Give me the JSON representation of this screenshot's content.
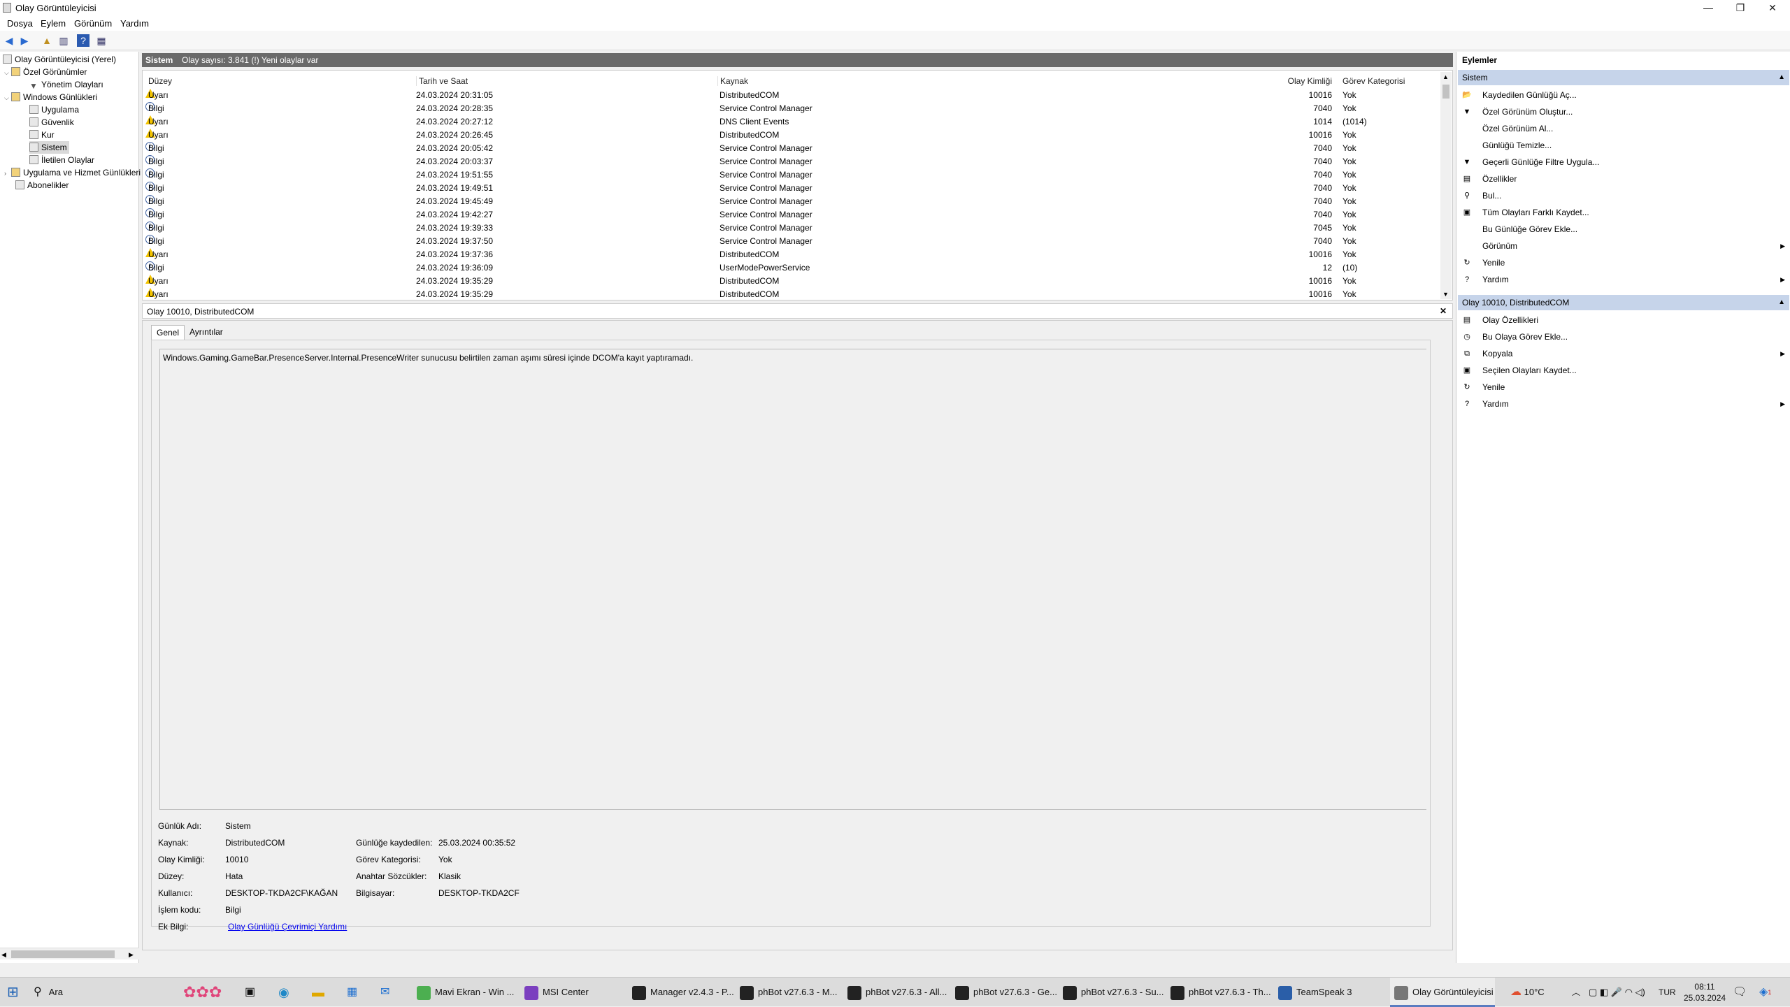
{
  "window": {
    "title": "Olay Görüntüleyicisi",
    "controls": {
      "minimize": "—",
      "restore": "❐",
      "close": "✕"
    }
  },
  "menu": [
    "Dosya",
    "Eylem",
    "Görünüm",
    "Yardım"
  ],
  "tree": {
    "items": [
      {
        "label": "Olay Görüntüleyicisi (Yerel)",
        "icon": "event-viewer-icon"
      },
      {
        "label": "Özel Görünümler",
        "icon": "folder-icon",
        "toggle": "⌵"
      },
      {
        "label": "Yönetim Olayları",
        "icon": "filter-icon"
      },
      {
        "label": "Windows Günlükleri",
        "icon": "folder-icon",
        "toggle": "⌵"
      },
      {
        "label": "Uygulama",
        "icon": "log-icon"
      },
      {
        "label": "Güvenlik",
        "icon": "log-icon"
      },
      {
        "label": "Kur",
        "icon": "log-icon"
      },
      {
        "label": "Sistem",
        "icon": "log-icon"
      },
      {
        "label": "İletilen Olaylar",
        "icon": "log-icon"
      },
      {
        "label": "Uygulama ve Hizmet Günlükleri",
        "icon": "folder-icon",
        "toggle": "›"
      },
      {
        "label": "Abonelikler",
        "icon": "subscriptions-icon"
      }
    ]
  },
  "list": {
    "title": "Sistem",
    "subtitle": "Olay sayısı: 3.841 (!) Yeni olaylar var",
    "columns": [
      "Düzey",
      "Tarih ve Saat",
      "Kaynak",
      "Olay Kimliği",
      "Görev Kategorisi"
    ],
    "rows": [
      {
        "level": "Uyarı",
        "type": "warn",
        "date": "24.03.2024 20:31:05",
        "source": "DistributedCOM",
        "id": "10016",
        "category": "Yok"
      },
      {
        "level": "Bilgi",
        "type": "info",
        "date": "24.03.2024 20:28:35",
        "source": "Service Control Manager",
        "id": "7040",
        "category": "Yok"
      },
      {
        "level": "Uyarı",
        "type": "warn",
        "date": "24.03.2024 20:27:12",
        "source": "DNS Client Events",
        "id": "1014",
        "category": "(1014)"
      },
      {
        "level": "Uyarı",
        "type": "warn",
        "date": "24.03.2024 20:26:45",
        "source": "DistributedCOM",
        "id": "10016",
        "category": "Yok"
      },
      {
        "level": "Bilgi",
        "type": "info",
        "date": "24.03.2024 20:05:42",
        "source": "Service Control Manager",
        "id": "7040",
        "category": "Yok"
      },
      {
        "level": "Bilgi",
        "type": "info",
        "date": "24.03.2024 20:03:37",
        "source": "Service Control Manager",
        "id": "7040",
        "category": "Yok"
      },
      {
        "level": "Bilgi",
        "type": "info",
        "date": "24.03.2024 19:51:55",
        "source": "Service Control Manager",
        "id": "7040",
        "category": "Yok"
      },
      {
        "level": "Bilgi",
        "type": "info",
        "date": "24.03.2024 19:49:51",
        "source": "Service Control Manager",
        "id": "7040",
        "category": "Yok"
      },
      {
        "level": "Bilgi",
        "type": "info",
        "date": "24.03.2024 19:45:49",
        "source": "Service Control Manager",
        "id": "7040",
        "category": "Yok"
      },
      {
        "level": "Bilgi",
        "type": "info",
        "date": "24.03.2024 19:42:27",
        "source": "Service Control Manager",
        "id": "7040",
        "category": "Yok"
      },
      {
        "level": "Bilgi",
        "type": "info",
        "date": "24.03.2024 19:39:33",
        "source": "Service Control Manager",
        "id": "7045",
        "category": "Yok"
      },
      {
        "level": "Bilgi",
        "type": "info",
        "date": "24.03.2024 19:37:50",
        "source": "Service Control Manager",
        "id": "7040",
        "category": "Yok"
      },
      {
        "level": "Uyarı",
        "type": "warn",
        "date": "24.03.2024 19:37:36",
        "source": "DistributedCOM",
        "id": "10016",
        "category": "Yok"
      },
      {
        "level": "Bilgi",
        "type": "info",
        "date": "24.03.2024 19:36:09",
        "source": "UserModePowerService",
        "id": "12",
        "category": "(10)"
      },
      {
        "level": "Uyarı",
        "type": "warn",
        "date": "24.03.2024 19:35:29",
        "source": "DistributedCOM",
        "id": "10016",
        "category": "Yok"
      },
      {
        "level": "Uyarı",
        "type": "warn",
        "date": "24.03.2024 19:35:29",
        "source": "DistributedCOM",
        "id": "10016",
        "category": "Yok"
      }
    ]
  },
  "detail": {
    "header": "Olay 10010, DistributedCOM",
    "close": "✕",
    "tabs": [
      "Genel",
      "Ayrıntılar"
    ],
    "message": "Windows.Gaming.GameBar.PresenceServer.Internal.PresenceWriter sunucusu belirtilen zaman aşımı süresi içinde DCOM'a kayıt yaptıramadı.",
    "fields": {
      "log_name_label": "Günlük Adı:",
      "log_name": "Sistem",
      "source_label": "Kaynak:",
      "source": "DistributedCOM",
      "logged_label": "Günlüğe kaydedilen:",
      "logged": "25.03.2024 00:35:52",
      "event_id_label": "Olay Kimliği:",
      "event_id": "10010",
      "task_label": "Görev Kategorisi:",
      "task": "Yok",
      "level_label": "Düzey:",
      "level": "Hata",
      "keywords_label": "Anahtar Sözcükler:",
      "keywords": "Klasik",
      "user_label": "Kullanıcı:",
      "user": "DESKTOP-TKDA2CF\\KAĞAN",
      "computer_label": "Bilgisayar:",
      "computer": "DESKTOP-TKDA2CF",
      "opcode_label": "İşlem kodu:",
      "opcode": "Bilgi",
      "more_label": "Ek Bilgi:",
      "more_link": "Olay Günlüğü Çevrimiçi Yardımı"
    }
  },
  "actions": {
    "title": "Eylemler",
    "section1": "Sistem",
    "items1": [
      {
        "label": "Kaydedilen Günlüğü Aç...",
        "icon": "open-folder-icon",
        "glyph": "📂"
      },
      {
        "label": "Özel Görünüm Oluştur...",
        "icon": "filter-icon",
        "glyph": "▼"
      },
      {
        "label": "Özel Görünüm Al...",
        "icon": "",
        "glyph": ""
      },
      {
        "label": "Günlüğü Temizle...",
        "icon": "",
        "glyph": ""
      },
      {
        "label": "Geçerli Günlüğe Filtre Uygula...",
        "icon": "filter-icon",
        "glyph": "▼"
      },
      {
        "label": "Özellikler",
        "icon": "properties-icon",
        "glyph": "▤"
      },
      {
        "label": "Bul...",
        "icon": "find-icon",
        "glyph": "⚲"
      },
      {
        "label": "Tüm Olayları Farklı Kaydet...",
        "icon": "save-icon",
        "glyph": "▣"
      },
      {
        "label": "Bu Günlüğe Görev Ekle...",
        "icon": "",
        "glyph": ""
      },
      {
        "label": "Görünüm",
        "icon": "",
        "glyph": "",
        "submenu": "▶"
      },
      {
        "label": "Yenile",
        "icon": "refresh-icon",
        "glyph": "↻"
      },
      {
        "label": "Yardım",
        "icon": "help-icon",
        "glyph": "?",
        "submenu": "▶"
      }
    ],
    "section2": "Olay 10010, DistributedCOM",
    "items2": [
      {
        "label": "Olay Özellikleri",
        "icon": "properties-icon",
        "glyph": "▤"
      },
      {
        "label": "Bu Olaya Görev Ekle...",
        "icon": "task-icon",
        "glyph": "◷"
      },
      {
        "label": "Kopyala",
        "icon": "copy-icon",
        "glyph": "⧉",
        "submenu": "▶"
      },
      {
        "label": "Seçilen Olayları Kaydet...",
        "icon": "save-icon",
        "glyph": "▣"
      },
      {
        "label": "Yenile",
        "icon": "refresh-icon",
        "glyph": "↻"
      },
      {
        "label": "Yardım",
        "icon": "help-icon",
        "glyph": "?",
        "submenu": "▶"
      }
    ],
    "collapse": "▲"
  },
  "taskbar": {
    "search": "Ara",
    "apps": [
      {
        "label": "Mavi Ekran - Win ...",
        "icon": "chrome-icon",
        "color": "#4caf50"
      },
      {
        "label": "MSI Center",
        "icon": "msi-center-icon",
        "color": "#7b3fbf"
      },
      {
        "label": "Manager v2.4.3 - P...",
        "icon": "phbot-icon",
        "color": "#222222"
      },
      {
        "label": "phBot v27.6.3 - M...",
        "icon": "phbot-icon",
        "color": "#222222"
      },
      {
        "label": "phBot v27.6.3 - All...",
        "icon": "phbot-icon",
        "color": "#222222"
      },
      {
        "label": "phBot v27.6.3 - Ge...",
        "icon": "phbot-icon",
        "color": "#222222"
      },
      {
        "label": "phBot v27.6.3 - Su...",
        "icon": "phbot-icon",
        "color": "#222222"
      },
      {
        "label": "phBot v27.6.3 - Th...",
        "icon": "phbot-icon",
        "color": "#222222"
      },
      {
        "label": "TeamSpeak 3",
        "icon": "teamspeak-icon",
        "color": "#2a5ea8"
      },
      {
        "label": "Olay Görüntüleyicisi",
        "icon": "event-viewer-icon",
        "color": "#777777"
      }
    ],
    "weather": "10°C",
    "lang": "TUR",
    "time": "08:11",
    "date": "25.03.2024",
    "notif_badge": "1"
  }
}
